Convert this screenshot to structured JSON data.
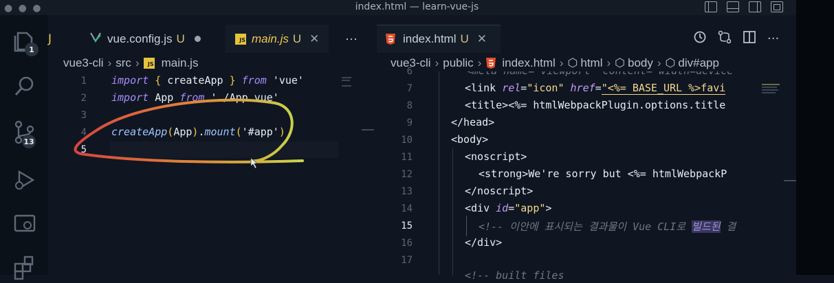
{
  "window": {
    "title": "index.html — learn-vue-js"
  },
  "activity_bar": {
    "explorer_badge": "1",
    "scm_badge": "13"
  },
  "tabs_left": [
    {
      "label": "vue.config.js",
      "status": "U"
    },
    {
      "label": "main.js",
      "status": "U"
    }
  ],
  "tab_left_partial": "J",
  "tabs_more": "···",
  "tab_right": {
    "label": "index.html",
    "status": "U"
  },
  "breadcrumb_left": {
    "root": "vue3-cli",
    "folder": "src",
    "file": "main.js"
  },
  "breadcrumb_right": {
    "root": "vue3-cli",
    "folder": "public",
    "file": "index.html",
    "n1": "html",
    "n2": "body",
    "n3": "div#app"
  },
  "left_lines": [
    "1",
    "2",
    "3",
    "4",
    "5"
  ],
  "left_code": {
    "l1_kw": "import",
    "l1_b1": "{",
    "l1_name": " createApp ",
    "l1_b2": "}",
    "l1_from": "from",
    "l1_str": "'vue'",
    "l2_kw": "import",
    "l2_name": " App ",
    "l2_from": "from",
    "l2_str": "'./App.vue'",
    "l4_fn": "createApp",
    "l4_p1": "(",
    "l4_arg": "App",
    "l4_p2": ")",
    "l4_dot": ".",
    "l4_fn2": "mount",
    "l4_p3": "(",
    "l4_str": "'#app'",
    "l4_p4": ")"
  },
  "right_lines": [
    "6",
    "7",
    "8",
    "9",
    "10",
    "11",
    "12",
    "13",
    "14",
    "15",
    "16",
    "17"
  ],
  "right_code": {
    "l6": "<meta name=\"viewport\" content=\"width=device",
    "l7_a": "<link ",
    "l7_attr1": "rel",
    "l7_eq1": "=",
    "l7_v1": "\"icon\"",
    "l7_attr2": " href",
    "l7_eq2": "=",
    "l7_v2": "\"<%= BASE_URL %>favi",
    "l8": "<title><%= htmlWebpackPlugin.options.title",
    "l9": "</head>",
    "l10": "<body>",
    "l11": "<noscript>",
    "l12": "<strong>We're sorry but <%= htmlWebpackP",
    "l13": "</noscript>",
    "l14_a": "<div ",
    "l14_attr": "id",
    "l14_eq": "=",
    "l14_v": "\"app\"",
    "l14_b": ">",
    "l15_a": "<!-- 이안에 표시되는 결과물이 Vue CLI로 ",
    "l15_hl": "빌드된",
    "l15_b": " 결",
    "l16": "</div>",
    "l17": "",
    "l18": "<!-- built files"
  },
  "colors": {
    "accent_js": "#e6c33c",
    "accent_html": "#e44d26",
    "annotation_stroke": "#d9443f",
    "annotation_stroke_end": "#c9d84a"
  }
}
